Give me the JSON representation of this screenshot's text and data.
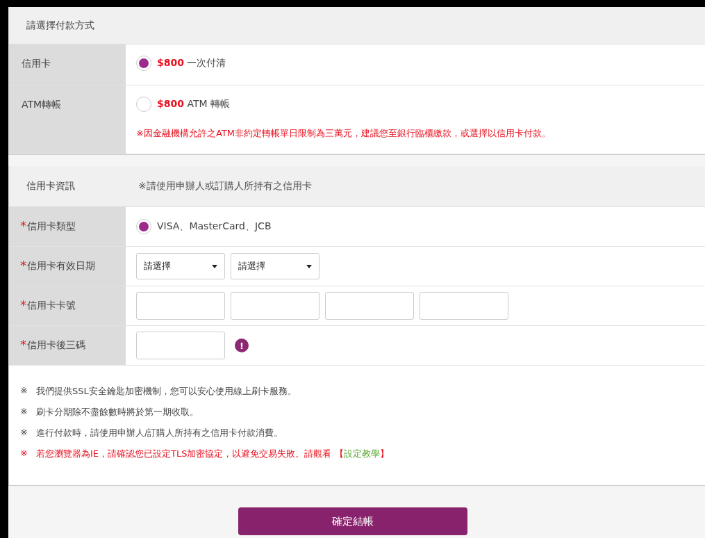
{
  "payment": {
    "title": "請選擇付款方式",
    "options": [
      {
        "label": "信用卡",
        "selected": true,
        "amount": "$800",
        "text": "一次付清"
      },
      {
        "label": "ATM轉帳",
        "selected": false,
        "amount": "$800",
        "text": "ATM 轉帳",
        "note": "※因金融機構允許之ATM非約定轉帳單日限制為三萬元，建議您至銀行臨櫃繳款，或選擇以信用卡付款。"
      }
    ]
  },
  "card_info": {
    "title": "信用卡資訊",
    "hint": "※請使用申辦人或訂購人所持有之信用卡",
    "rows": [
      {
        "kind": "radio",
        "required_mark": "*",
        "label": "信用卡類型",
        "selected": true,
        "text": "VISA、MasterCard、JCB"
      },
      {
        "kind": "selects",
        "required_mark": "*",
        "label": "信用卡有效日期",
        "selects": [
          "請選擇",
          "請選擇"
        ]
      },
      {
        "kind": "inputs",
        "required_mark": "*",
        "label": "信用卡卡號"
      },
      {
        "kind": "cvv",
        "required_mark": "*",
        "label": "信用卡後三碼",
        "info_icon": "!"
      }
    ]
  },
  "notes": [
    {
      "kind": "normal",
      "mark": "※",
      "text": "我們提供SSL安全鑰匙加密機制，您可以安心使用線上刷卡服務。"
    },
    {
      "kind": "normal",
      "mark": "※",
      "text": "刷卡分期除不盡餘數時將於第一期收取。"
    },
    {
      "kind": "normal",
      "mark": "※",
      "text": "進行付款時，請使用申辦人/訂購人所持有之信用卡付款消費。"
    },
    {
      "kind": "warning",
      "mark": "※",
      "text": "若您瀏覽器為IE，請確認您已設定TLS加密協定，以避免交易失敗。請觀看 【",
      "link": "設定教學",
      "after": "】"
    }
  ],
  "submit": "確定結帳"
}
